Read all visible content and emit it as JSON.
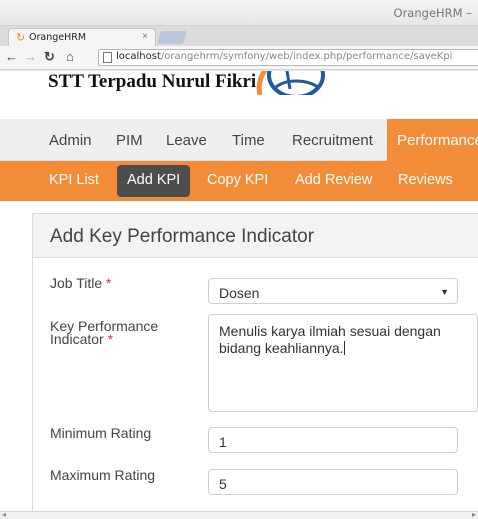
{
  "browser": {
    "window_title": "OrangeHRM –",
    "tab_title": "OrangeHRM",
    "tab_close": "×",
    "url_host": "localhost",
    "url_path": "/orangehrm/symfony/web/index.php/performance/saveKpi"
  },
  "header": {
    "brand": "STT Terpadu Nurul Fikri"
  },
  "main_menu": [
    {
      "label": "Admin"
    },
    {
      "label": "PIM"
    },
    {
      "label": "Leave"
    },
    {
      "label": "Time"
    },
    {
      "label": "Recruitment"
    },
    {
      "label": "Performance",
      "active": true
    }
  ],
  "sub_menu": [
    {
      "label": "KPI List"
    },
    {
      "label": "Add KPI",
      "active": true
    },
    {
      "label": "Copy KPI"
    },
    {
      "label": "Add Review"
    },
    {
      "label": "Reviews"
    }
  ],
  "form": {
    "title": "Add Key Performance Indicator",
    "job_title": {
      "label": "Job Title",
      "required_mark": "*",
      "value": "Dosen"
    },
    "kpi": {
      "label_line1": "Key Performance",
      "label_line2": "Indicator",
      "required_mark": "*",
      "value": "Menulis karya ilmiah sesuai dengan bidang keahliannya."
    },
    "min_rating": {
      "label": "Minimum Rating",
      "value": "1"
    },
    "max_rating": {
      "label": "Maximum Rating",
      "value": "5"
    }
  },
  "colors": {
    "accent": "#f28c38",
    "active_sub": "#4d4d4d",
    "required": "#e03a1e"
  },
  "icons": [
    "reload-icon",
    "back-icon",
    "forward-icon",
    "home-icon",
    "page-icon",
    "dropdown-caret-icon"
  ]
}
